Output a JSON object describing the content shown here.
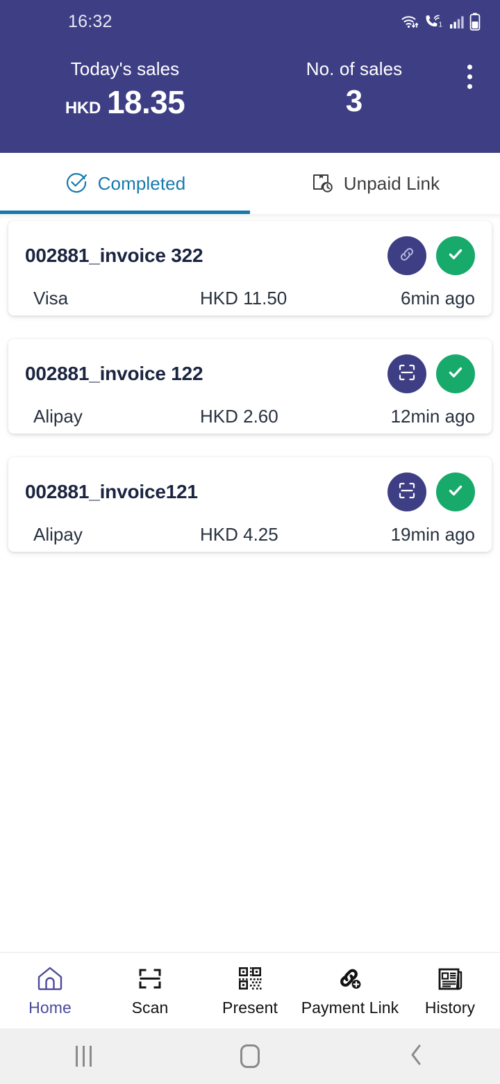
{
  "status_bar": {
    "time": "16:32",
    "icons": [
      "wifi-data-icon",
      "call-signal-icon",
      "cellular-signal-icon",
      "battery-icon"
    ],
    "sim_label": "1"
  },
  "header": {
    "background_color": "#3E3E85",
    "todays_sales_label": "Today's sales",
    "currency": "HKD",
    "todays_sales_amount": "18.35",
    "no_of_sales_label": "No. of sales",
    "no_of_sales_value": "3",
    "overflow_menu": "more-options"
  },
  "tabs": {
    "active_index": 0,
    "active_color": "#1679AC",
    "items": [
      {
        "label": "Completed",
        "icon": "circle-check-icon"
      },
      {
        "label": "Unpaid Link",
        "icon": "package-clock-icon"
      }
    ]
  },
  "transactions": {
    "method_badge_color": "#3E3E85",
    "status_badge_color": "#17AA6B",
    "items": [
      {
        "title": "002881_invoice 322",
        "method": "Visa",
        "amount": "HKD 11.50",
        "time": "6min ago",
        "source_icon": "link-icon",
        "status_icon": "check-icon"
      },
      {
        "title": "002881_invoice 122",
        "method": "Alipay",
        "amount": "HKD 2.60",
        "time": "12min ago",
        "source_icon": "scan-icon",
        "status_icon": "check-icon"
      },
      {
        "title": "002881_invoice121",
        "method": "Alipay",
        "amount": "HKD 4.25",
        "time": "19min ago",
        "source_icon": "scan-icon",
        "status_icon": "check-icon"
      }
    ]
  },
  "bottom_nav": {
    "active_index": 0,
    "active_color": "#4A4A9E",
    "items": [
      {
        "label": "Home",
        "icon": "home-icon"
      },
      {
        "label": "Scan",
        "icon": "scan-frame-icon"
      },
      {
        "label": "Present",
        "icon": "qr-code-icon"
      },
      {
        "label": "Payment Link",
        "icon": "link-plus-icon"
      },
      {
        "label": "History",
        "icon": "newspaper-icon"
      }
    ]
  },
  "system_nav": {
    "buttons": [
      "recents-icon",
      "home-icon",
      "back-icon"
    ]
  }
}
